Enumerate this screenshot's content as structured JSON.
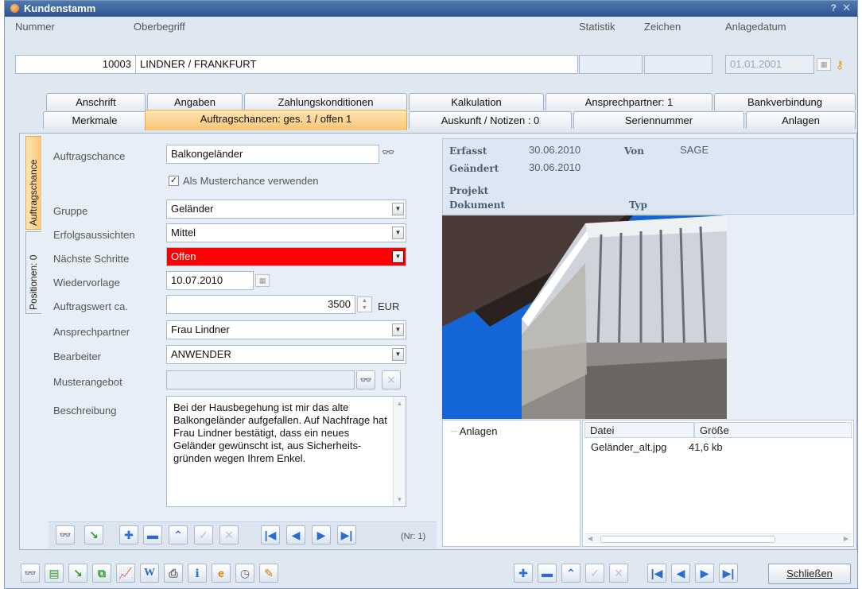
{
  "window": {
    "title": "Kundenstamm",
    "help": "?",
    "close": "✕"
  },
  "header": {
    "nummer_label": "Nummer",
    "nummer_value": "10003",
    "oberbegriff_label": "Oberbegriff",
    "oberbegriff_value": "LINDNER / FRANKFURT",
    "statistik_label": "Statistik",
    "zeichen_label": "Zeichen",
    "anlagedatum_label": "Anlagedatum",
    "anlagedatum_value": "01.01.2001"
  },
  "tabs_row1": [
    "Anschrift",
    "Angaben",
    "Zahlungskonditionen",
    "Kalkulation",
    "Ansprechpartner: 1",
    "Bankverbindung"
  ],
  "tabs_row2": [
    "Merkmale",
    "Auftragschancen: ges. 1 / offen 1",
    "Auskunft / Notizen : 0",
    "Seriennummer",
    "Anlagen"
  ],
  "side_tabs": [
    "Auftragschance",
    "Positionen: 0"
  ],
  "form": {
    "auftragschance_label": "Auftragschance",
    "auftragschance_value": "Balkongeländer",
    "muster_check_label": "Als Musterchance verwenden",
    "gruppe_label": "Gruppe",
    "gruppe_value": "Geländer",
    "erfolg_label": "Erfolgsaussichten",
    "erfolg_value": "Mittel",
    "schritte_label": "Nächste Schritte",
    "schritte_value": "Offen",
    "wiedervorlage_label": "Wiedervorlage",
    "wiedervorlage_value": "10.07.2010",
    "auftragswert_label": "Auftragswert ca.",
    "auftragswert_value": "3500",
    "currency": "EUR",
    "ansprechpartner_label": "Ansprechpartner",
    "ansprechpartner_value": "Frau Lindner",
    "bearbeiter_label": "Bearbeiter",
    "bearbeiter_value": "ANWENDER",
    "musterangebot_label": "Musterangebot",
    "musterangebot_value": "",
    "beschreibung_label": "Beschreibung",
    "beschreibung_value": "Bei der Hausbegehung ist mir das alte Balkongeländer aufgefallen. Auf Nachfrage hat Frau Lindner bestätigt, dass ein neues Geländer gewünscht ist, aus Sicherheits-gründen wegen Ihrem Enkel.",
    "record_no": "(Nr: 1)"
  },
  "info": {
    "erfasst_label": "Erfasst",
    "erfasst_value": "30.06.2010",
    "von_label": "Von",
    "von_value": "SAGE",
    "geaendert_label": "Geändert",
    "geaendert_value": "30.06.2010",
    "projekt_label": "Projekt",
    "dokument_label": "Dokument",
    "typ_label": "Typ"
  },
  "attachments": {
    "tree_root": "Anlagen",
    "col_datei": "Datei",
    "col_groesse": "Größe",
    "rows": [
      {
        "datei": "Geländer_alt.jpg",
        "groesse": "41,6 kb"
      }
    ]
  },
  "footer": {
    "close_label": "Schließen"
  },
  "colors": {
    "title_bar": "#2d5590",
    "active_tab": "#f8c676",
    "status_red": "#ff0000",
    "panel_bg": "#e7eef7"
  }
}
